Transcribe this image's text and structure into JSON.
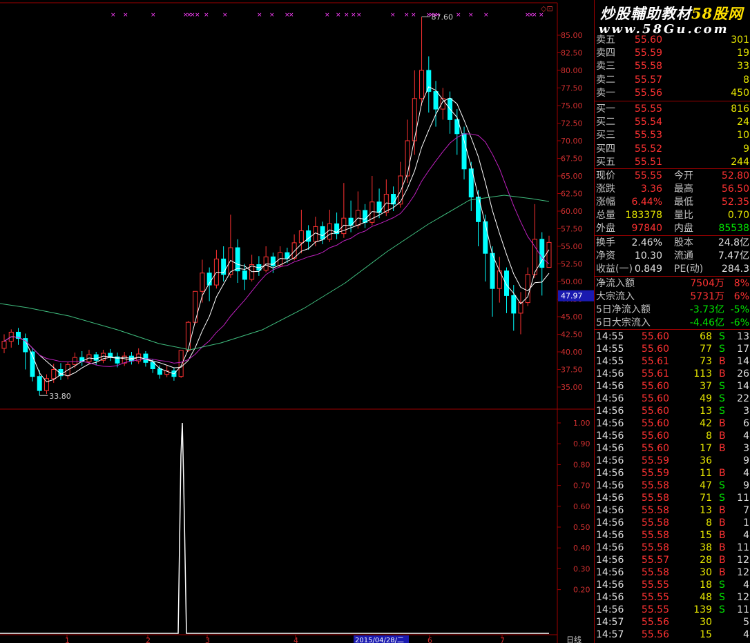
{
  "chart": {
    "price_labels": [
      "85.00",
      "82.50",
      "80.00",
      "77.50",
      "75.00",
      "72.50",
      "70.00",
      "67.50",
      "65.00",
      "62.50",
      "60.00",
      "57.50",
      "55.00",
      "52.50",
      "50.00",
      "47.50",
      "45.00",
      "42.50",
      "40.00",
      "37.50",
      "35.00"
    ],
    "current_price_tag": "47.97",
    "high_marker": "87.60",
    "low_marker": "33.80",
    "indicator_labels": [
      "1.00",
      "0.90",
      "0.80",
      "0.70",
      "0.60",
      "0.50",
      "0.40",
      "0.30",
      "0.20"
    ],
    "date_label": "2015/04/28/二",
    "period_label": "日线",
    "bottom_ticks": [
      "1",
      "2",
      "3",
      "4",
      "6",
      "7"
    ]
  },
  "colors": {
    "up": "#ff3232",
    "down": "#00ffff",
    "ma5": "#ffffff",
    "ma10": "#ffffff",
    "ma20": "#c020c0",
    "ma60": "#40c080",
    "grid": "#a00000",
    "axis_text": "#d03030",
    "indicator_line": "#ffffff",
    "signal_marks": "#ff40ff",
    "price_tag_bg": "#1a1ab0"
  },
  "panel": {
    "watermark_line1_a": "炒股輔助教材",
    "watermark_line1_b": "58股网",
    "watermark_line2": "www.58Gu.com",
    "sell": [
      {
        "label": "卖五",
        "price": "55.60",
        "vol": "301"
      },
      {
        "label": "卖四",
        "price": "55.59",
        "vol": "19"
      },
      {
        "label": "卖三",
        "price": "55.58",
        "vol": "33"
      },
      {
        "label": "卖二",
        "price": "55.57",
        "vol": "8"
      },
      {
        "label": "卖一",
        "price": "55.56",
        "vol": "450"
      }
    ],
    "buy": [
      {
        "label": "买一",
        "price": "55.55",
        "vol": "816"
      },
      {
        "label": "买二",
        "price": "55.54",
        "vol": "24"
      },
      {
        "label": "买三",
        "price": "55.53",
        "vol": "10"
      },
      {
        "label": "买四",
        "price": "55.52",
        "vol": "9"
      },
      {
        "label": "买五",
        "price": "55.51",
        "vol": "244"
      }
    ],
    "quote": [
      {
        "l1": "现价",
        "v1": "55.55",
        "l2": "今开",
        "v2": "52.80"
      },
      {
        "l1": "涨跌",
        "v1": "3.36",
        "l2": "最高",
        "v2": "56.50"
      },
      {
        "l1": "涨幅",
        "v1": "6.44%",
        "l2": "最低",
        "v2": "52.35"
      },
      {
        "l1": "总量",
        "v1": "183378",
        "l2": "量比",
        "v2": "0.70"
      },
      {
        "l1": "外盘",
        "v1": "97840",
        "l2": "内盘",
        "v2": "85538"
      }
    ],
    "stats": [
      {
        "l1": "换手",
        "v1": "2.46%",
        "l2": "股本",
        "v2": "24.8亿"
      },
      {
        "l1": "净资",
        "v1": "10.30",
        "l2": "流通",
        "v2": "7.47亿"
      },
      {
        "l1": "收益(一)",
        "v1": "0.849",
        "l2": "PE(动)",
        "v2": "284.3"
      }
    ],
    "flows": [
      {
        "label": "净流入额",
        "value": "7504万",
        "pct": "8%"
      },
      {
        "label": "大宗流入",
        "value": "5731万",
        "pct": "6%"
      },
      {
        "label": "5日净流入额",
        "value": "-3.73亿",
        "pct": "-5%"
      },
      {
        "label": "5日大宗流入",
        "value": "-4.46亿",
        "pct": "-6%"
      }
    ],
    "ticks": [
      {
        "time": "14:55",
        "price": "55.60",
        "vol": "68",
        "bs": "S",
        "n": "13"
      },
      {
        "time": "14:55",
        "price": "55.60",
        "vol": "77",
        "bs": "S",
        "n": "17"
      },
      {
        "time": "14:55",
        "price": "55.61",
        "vol": "73",
        "bs": "B",
        "n": "14"
      },
      {
        "time": "14:56",
        "price": "55.61",
        "vol": "113",
        "bs": "B",
        "n": "26"
      },
      {
        "time": "14:56",
        "price": "55.60",
        "vol": "37",
        "bs": "S",
        "n": "14"
      },
      {
        "time": "14:56",
        "price": "55.60",
        "vol": "49",
        "bs": "S",
        "n": "22"
      },
      {
        "time": "14:56",
        "price": "55.60",
        "vol": "13",
        "bs": "S",
        "n": "3"
      },
      {
        "time": "14:56",
        "price": "55.60",
        "vol": "42",
        "bs": "B",
        "n": "6"
      },
      {
        "time": "14:56",
        "price": "55.60",
        "vol": "8",
        "bs": "B",
        "n": "4"
      },
      {
        "time": "14:56",
        "price": "55.60",
        "vol": "17",
        "bs": "B",
        "n": "3"
      },
      {
        "time": "14:56",
        "price": "55.59",
        "vol": "36",
        "bs": "",
        "n": "9"
      },
      {
        "time": "14:56",
        "price": "55.59",
        "vol": "11",
        "bs": "B",
        "n": "4"
      },
      {
        "time": "14:56",
        "price": "55.58",
        "vol": "47",
        "bs": "S",
        "n": "9"
      },
      {
        "time": "14:56",
        "price": "55.58",
        "vol": "71",
        "bs": "S",
        "n": "11"
      },
      {
        "time": "14:56",
        "price": "55.58",
        "vol": "13",
        "bs": "B",
        "n": "7"
      },
      {
        "time": "14:56",
        "price": "55.58",
        "vol": "8",
        "bs": "B",
        "n": "1"
      },
      {
        "time": "14:56",
        "price": "55.58",
        "vol": "15",
        "bs": "B",
        "n": "4"
      },
      {
        "time": "14:56",
        "price": "55.58",
        "vol": "38",
        "bs": "B",
        "n": "11"
      },
      {
        "time": "14:56",
        "price": "55.57",
        "vol": "28",
        "bs": "B",
        "n": "12"
      },
      {
        "time": "14:56",
        "price": "55.58",
        "vol": "30",
        "bs": "B",
        "n": "12"
      },
      {
        "time": "14:56",
        "price": "55.55",
        "vol": "18",
        "bs": "S",
        "n": "4"
      },
      {
        "time": "14:56",
        "price": "55.55",
        "vol": "48",
        "bs": "S",
        "n": "12"
      },
      {
        "time": "14:56",
        "price": "55.55",
        "vol": "139",
        "bs": "S",
        "n": "11"
      },
      {
        "time": "14:57",
        "price": "55.56",
        "vol": "30",
        "bs": "",
        "n": "5"
      },
      {
        "time": "14:57",
        "price": "55.56",
        "vol": "15",
        "bs": "",
        "n": "4"
      }
    ]
  },
  "chart_data": {
    "type": "candlestick",
    "price_axis": [
      35.0,
      85.0
    ],
    "high": 87.6,
    "low": 33.8,
    "candles_approx": [
      [
        40.5,
        41.5,
        39.8,
        42.5
      ],
      [
        41.5,
        42.8,
        40.6,
        43.2
      ],
      [
        42.8,
        41.9,
        41.0,
        43.4
      ],
      [
        41.9,
        40.0,
        37.5,
        42.6
      ],
      [
        40.0,
        36.5,
        35.8,
        40.6
      ],
      [
        36.5,
        34.5,
        33.8,
        37.4
      ],
      [
        34.5,
        36.2,
        34.0,
        36.8
      ],
      [
        36.2,
        37.5,
        35.6,
        38.3
      ],
      [
        37.5,
        36.6,
        36.0,
        38.4
      ],
      [
        36.6,
        38.2,
        36.1,
        38.6
      ],
      [
        38.2,
        39.2,
        37.7,
        39.9
      ],
      [
        39.2,
        38.6,
        38.0,
        40.1
      ],
      [
        38.6,
        39.6,
        38.2,
        40.3
      ],
      [
        39.6,
        38.8,
        38.1,
        40.0
      ],
      [
        38.8,
        39.8,
        38.4,
        40.3
      ],
      [
        39.8,
        39.3,
        38.7,
        40.4
      ],
      [
        39.3,
        38.4,
        37.8,
        39.9
      ],
      [
        38.4,
        39.4,
        38.0,
        40.0
      ],
      [
        39.4,
        38.7,
        38.2,
        40.0
      ],
      [
        38.7,
        39.7,
        38.3,
        40.5
      ],
      [
        39.7,
        38.5,
        37.9,
        40.1
      ],
      [
        38.5,
        37.6,
        37.0,
        39.0
      ],
      [
        37.6,
        36.8,
        36.2,
        38.1
      ],
      [
        36.8,
        37.3,
        36.4,
        38.0
      ],
      [
        37.3,
        36.5,
        35.9,
        37.8
      ],
      [
        36.5,
        40.2,
        36.3,
        40.2
      ],
      [
        40.2,
        44.2,
        40.0,
        44.4
      ],
      [
        44.2,
        48.6,
        44.0,
        48.6
      ],
      [
        48.6,
        51.2,
        47.0,
        53.1
      ],
      [
        51.2,
        49.5,
        47.2,
        52.0
      ],
      [
        49.5,
        53.2,
        49.0,
        54.5
      ],
      [
        53.2,
        51.0,
        50.0,
        55.0
      ],
      [
        51.0,
        54.8,
        50.5,
        59.5
      ],
      [
        54.8,
        51.5,
        49.8,
        56.0
      ],
      [
        51.5,
        50.3,
        48.8,
        52.5
      ],
      [
        50.3,
        52.4,
        50.0,
        53.8
      ],
      [
        52.4,
        51.6,
        50.8,
        53.6
      ],
      [
        51.6,
        53.5,
        51.3,
        55.0
      ],
      [
        53.5,
        52.2,
        51.2,
        54.1
      ],
      [
        52.2,
        54.1,
        52.0,
        55.0
      ],
      [
        54.1,
        53.3,
        52.6,
        54.8
      ],
      [
        53.3,
        55.5,
        53.0,
        56.7
      ],
      [
        55.5,
        57.2,
        54.0,
        60.2
      ],
      [
        57.2,
        55.7,
        54.5,
        58.0
      ],
      [
        55.7,
        57.8,
        55.0,
        59.2
      ],
      [
        57.8,
        56.0,
        55.3,
        58.5
      ],
      [
        56.0,
        58.2,
        55.6,
        60.2
      ],
      [
        58.2,
        56.8,
        56.0,
        59.8
      ],
      [
        56.8,
        59.0,
        56.2,
        64.0
      ],
      [
        59.0,
        58.0,
        57.0,
        61.5
      ],
      [
        58.0,
        60.1,
        57.5,
        62.8
      ],
      [
        60.1,
        58.4,
        57.6,
        61.0
      ],
      [
        58.4,
        61.3,
        58.0,
        65.0
      ],
      [
        61.3,
        59.8,
        59.0,
        63.2
      ],
      [
        59.8,
        62.4,
        59.3,
        64.5
      ],
      [
        62.4,
        61.0,
        60.0,
        63.5
      ],
      [
        61.0,
        65.0,
        60.5,
        67.0
      ],
      [
        65.0,
        70.0,
        64.0,
        73.0
      ],
      [
        70.0,
        76.0,
        68.0,
        80.0
      ],
      [
        76.0,
        80.0,
        75.0,
        87.6
      ],
      [
        80.0,
        77.0,
        74.0,
        82.0
      ],
      [
        77.0,
        74.5,
        72.0,
        78.5
      ],
      [
        74.5,
        76.0,
        73.0,
        77.5
      ],
      [
        76.0,
        73.0,
        71.0,
        77.0
      ],
      [
        73.0,
        71.0,
        68.0,
        74.5
      ],
      [
        71.0,
        66.0,
        64.5,
        72.0
      ],
      [
        66.0,
        62.0,
        60.0,
        67.0
      ],
      [
        62.0,
        58.5,
        55.0,
        63.0
      ],
      [
        58.5,
        54.0,
        50.0,
        59.5
      ],
      [
        54.0,
        49.0,
        45.0,
        55.0
      ],
      [
        49.0,
        51.5,
        47.0,
        53.5
      ],
      [
        51.5,
        48.0,
        45.5,
        52.0
      ],
      [
        48.0,
        45.5,
        43.0,
        49.5
      ],
      [
        45.5,
        47.0,
        42.5,
        48.5
      ],
      [
        47.0,
        51.0,
        46.5,
        52.0
      ],
      [
        51.0,
        56.0,
        50.5,
        61.0
      ],
      [
        56.0,
        52.0,
        48.0,
        57.0
      ],
      [
        52.0,
        55.55,
        52.35,
        56.5
      ]
    ]
  }
}
